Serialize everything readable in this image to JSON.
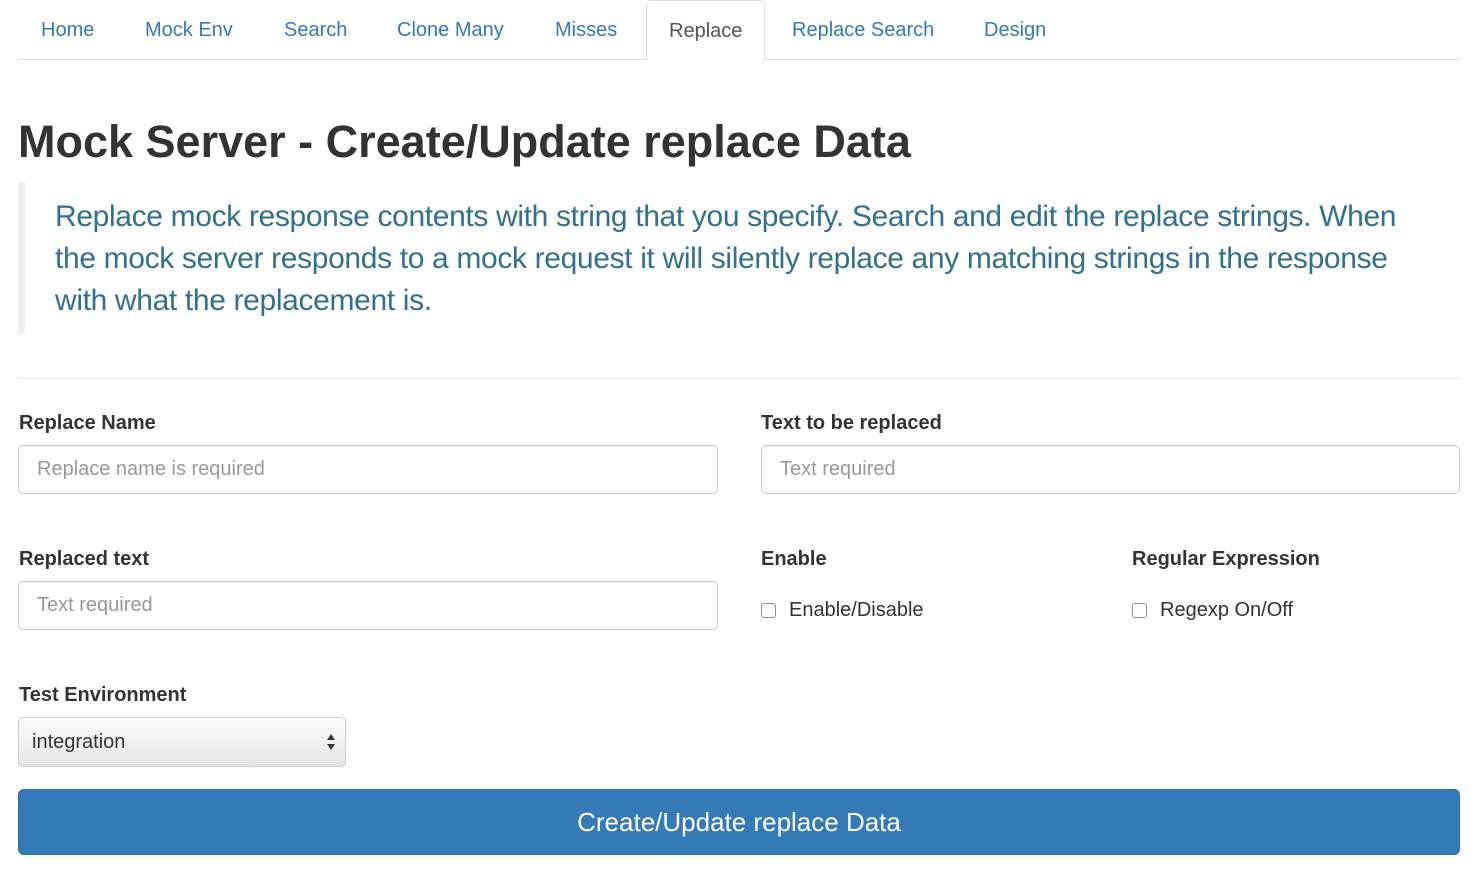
{
  "nav": {
    "tabs": [
      {
        "label": "Home"
      },
      {
        "label": "Mock Env"
      },
      {
        "label": "Search"
      },
      {
        "label": "Clone Many"
      },
      {
        "label": "Misses"
      },
      {
        "label": "Replace",
        "active": true
      },
      {
        "label": "Replace Search"
      },
      {
        "label": "Design"
      }
    ]
  },
  "page": {
    "title": "Mock Server - Create/Update replace Data",
    "description": "Replace mock response contents with string that you specify. Search and edit the replace strings. When the mock server responds to a mock request it will silently replace any matching strings in the response with what the replacement is."
  },
  "form": {
    "replace_name": {
      "label": "Replace Name",
      "value": "",
      "placeholder": "Replace name is required"
    },
    "text_to_replace": {
      "label": "Text to be replaced",
      "value": "",
      "placeholder": "Text required"
    },
    "replaced_text": {
      "label": "Replaced text",
      "value": "",
      "placeholder": "Text required"
    },
    "enable": {
      "label": "Enable",
      "checkbox_label": "Enable/Disable",
      "checked": false
    },
    "regexp": {
      "label": "Regular Expression",
      "checkbox_label": "Regexp On/Off",
      "checked": false
    },
    "test_env": {
      "label": "Test Environment",
      "selected": "integration"
    },
    "submit_label": "Create/Update replace Data"
  },
  "colors": {
    "link": "#337ab7",
    "primary_button": "#337ab7",
    "blockquote_text": "#31708f"
  }
}
